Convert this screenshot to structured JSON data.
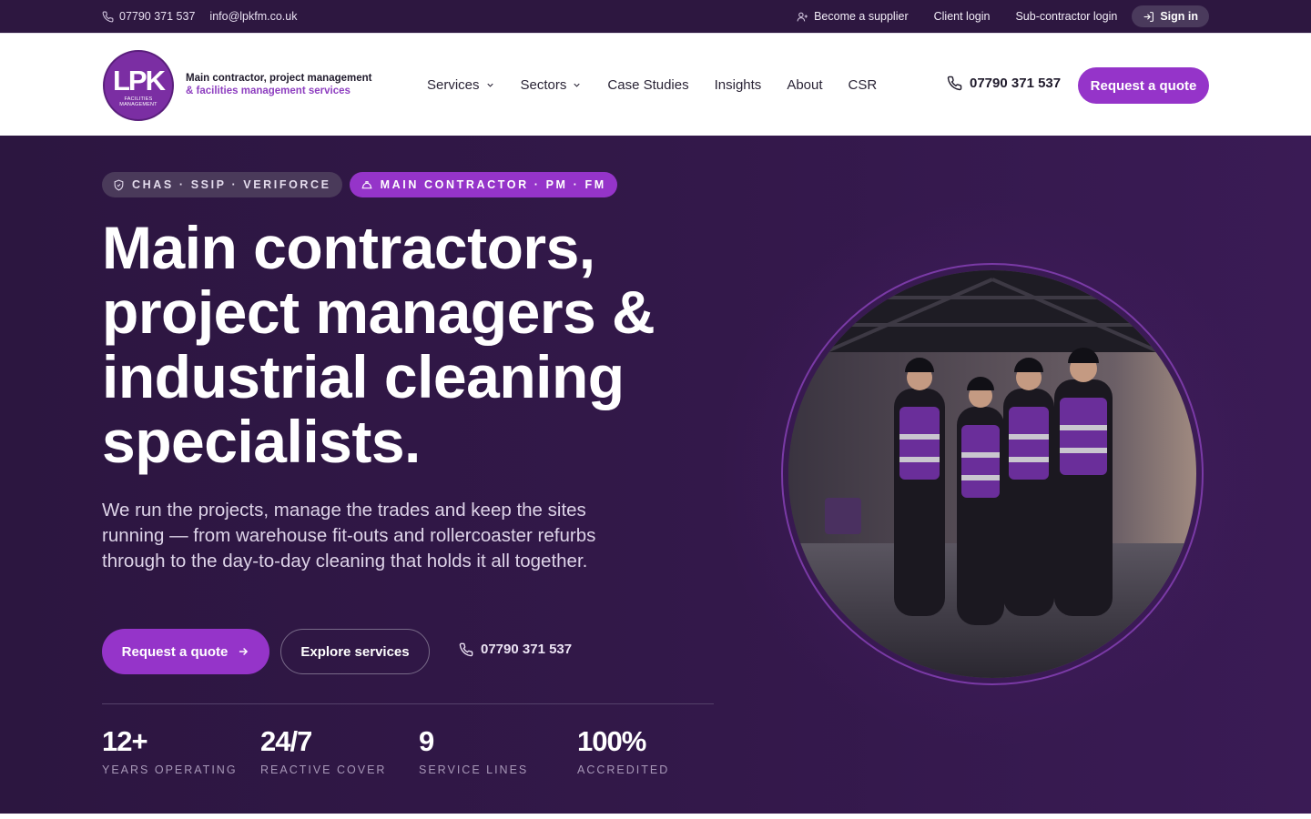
{
  "topbar": {
    "phone": "07790 371 537",
    "email": "info@lpkfm.co.uk",
    "become_supplier": "Become a supplier",
    "client_login": "Client login",
    "subcontractor_login": "Sub-contractor login",
    "sign_in": "Sign in"
  },
  "header": {
    "logo_text": "LPK",
    "logo_subtext": "FACILITIES MANAGEMENT",
    "tagline_line1": "Main contractor, project management",
    "tagline_line2": "& facilities management services",
    "nav": {
      "services": "Services",
      "sectors": "Sectors",
      "case_studies": "Case Studies",
      "insights": "Insights",
      "about": "About",
      "csr": "CSR"
    },
    "phone": "07790 371 537",
    "quote_button": "Request a quote"
  },
  "hero": {
    "badge_accreditations": "CHAS · SSIP · VERIFORCE",
    "badge_roles": "MAIN CONTRACTOR · PM · FM",
    "title": "Main contractors, project managers & industrial cleaning specialists.",
    "subtitle": "We run the projects, manage the trades and keep the sites running — from warehouse fit-outs and rollercoaster refurbs through to the day-to-day cleaning that holds it all together.",
    "cta_quote": "Request a quote",
    "cta_explore": "Explore services",
    "cta_phone": "07790 371 537",
    "stats": [
      {
        "value": "12+",
        "label": "YEARS OPERATING"
      },
      {
        "value": "24/7",
        "label": "REACTIVE COVER"
      },
      {
        "value": "9",
        "label": "SERVICE LINES"
      },
      {
        "value": "100%",
        "label": "ACCREDITED"
      }
    ]
  },
  "colors": {
    "topbar_bg": "#2d1740",
    "hero_bg": "#33184a",
    "accent_purple": "#9534c9",
    "brand_text_purple": "#8e3fc0"
  },
  "icons": {
    "topbar_phone": "phone-icon",
    "become_supplier": "user-plus-icon",
    "sign_in": "sign-in-icon",
    "nav_dropdown": "chevron-down-icon",
    "badge_accreditations": "shield-icon",
    "badge_roles": "hard-hat-icon",
    "cta_arrow": "arrow-right-icon"
  }
}
